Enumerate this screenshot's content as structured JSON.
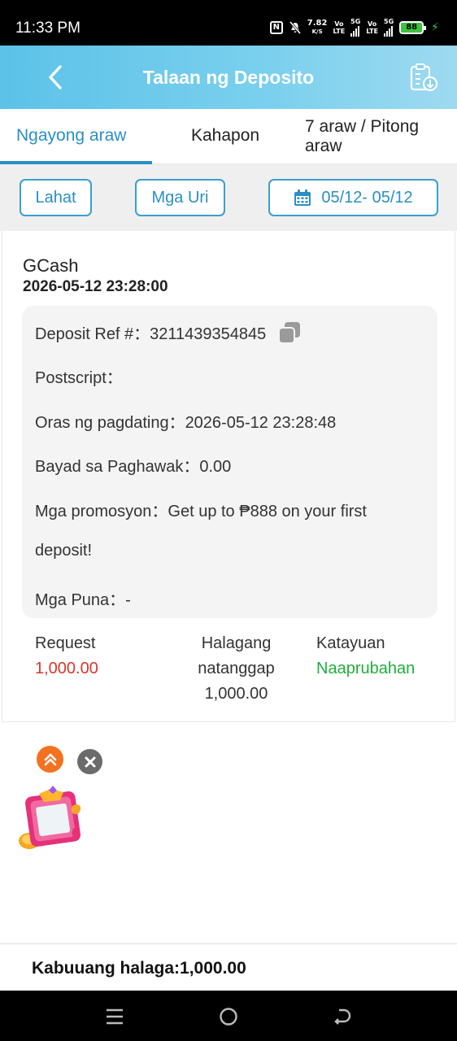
{
  "status_bar": {
    "time": "11:33 PM",
    "speed_value": "7.82",
    "speed_unit": "K/S",
    "net1_top": "Vo",
    "net1_bottom": "LTE",
    "net2": "5G",
    "net3_top": "Vo",
    "net3_bottom": "LTE",
    "net4": "5G",
    "battery": "88",
    "icons": [
      "nfc-icon",
      "mute-icon",
      "signal-icon",
      "battery-icon",
      "charging-icon"
    ]
  },
  "header": {
    "title": "Talaan ng Deposito",
    "icons": [
      "back-arrow-icon",
      "export-download-icon"
    ],
    "accent": "#5cc2e8"
  },
  "tabs": [
    {
      "label": "Ngayong araw",
      "active": true
    },
    {
      "label": "Kahapon",
      "active": false
    },
    {
      "label": "7 araw / Pitong araw",
      "active": false
    }
  ],
  "filters": {
    "all_label": "Lahat",
    "types_label": "Mga Uri",
    "date_range": "05/12- 05/12",
    "date_icon": "calendar-icon"
  },
  "record": {
    "provider": "GCash",
    "datetime": "2026-05-12 23:28:00",
    "ref_label": "Deposit Ref #：",
    "ref_value": "3211439354845",
    "postscript_label": "Postscript：",
    "arrival_label": "Oras ng pagdating：",
    "arrival_value": "2026-05-12 23:28:48",
    "fee_label": "Bayad sa Paghawak：",
    "fee_value": "0.00",
    "promo_label": "Mga promosyon：",
    "promo_value_line1": "Get up to ₱888 on your first",
    "promo_value_line2": "deposit!",
    "remarks_label": "Mga Puna：",
    "remarks_value": "-",
    "request_label": "Request",
    "request_value": "1,000.00",
    "received_label_line1": "Halagang",
    "received_label_line2": "natanggap",
    "received_value": "1,000.00",
    "status_label": "Katayuan",
    "status_value": "Naaprubahan",
    "colors": {
      "request": "#d9362b",
      "status": "#1fae3b"
    }
  },
  "total": {
    "label": "Kabuuang halaga:1,000.00"
  },
  "floating": {
    "icons": [
      "chevron-double-up-icon",
      "close-icon",
      "gift-box-icon"
    ]
  },
  "navbar": {
    "icons": [
      "menu-icon",
      "home-circle-icon",
      "back-icon"
    ]
  }
}
